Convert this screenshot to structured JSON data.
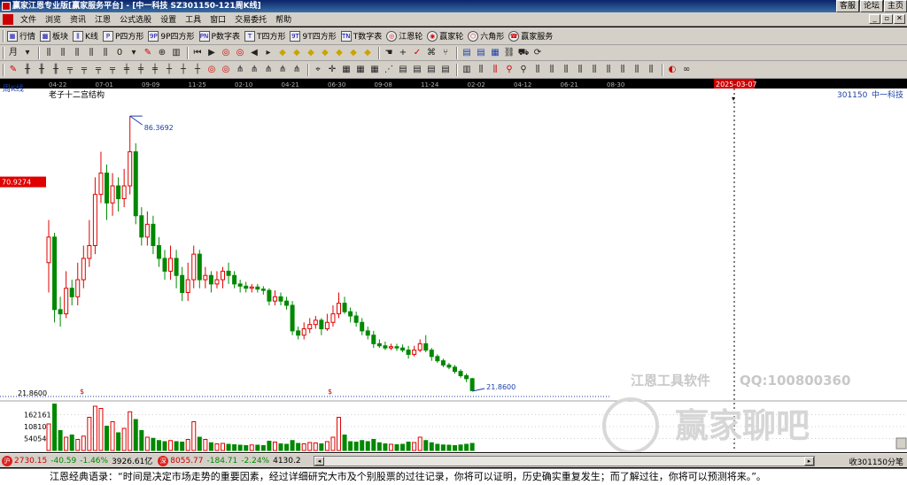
{
  "window": {
    "title": "赢家江恩专业版[赢家服务平台] - [中一科技   SZ301150-121周K线]",
    "links": [
      "客服",
      "论坛",
      "主页"
    ],
    "controls": [
      "_",
      "▫",
      "✕"
    ]
  },
  "menu": [
    "文件",
    "浏览",
    "资讯",
    "江恩",
    "公式选股",
    "设置",
    "工具",
    "窗口",
    "交易委托",
    "帮助"
  ],
  "toolbar1": [
    {
      "icon": "grid-icon",
      "glyph": "▦",
      "label": "行情"
    },
    {
      "icon": "sector-icon",
      "glyph": "▩",
      "label": "板块"
    },
    {
      "icon": "kline-icon",
      "glyph": "⫼",
      "label": "K线"
    },
    {
      "icon": "p-square-icon",
      "glyph": "P",
      "label": "P四方形"
    },
    {
      "icon": "9p-square-icon",
      "glyph": "9P",
      "label": "9P四方形"
    },
    {
      "icon": "p-number-icon",
      "glyph": "PN",
      "label": "P数字表"
    },
    {
      "icon": "t-square-icon",
      "glyph": "T",
      "label": "T四方形"
    },
    {
      "icon": "9t-square-icon",
      "glyph": "9T",
      "label": "9T四方形"
    },
    {
      "icon": "t-number-icon",
      "glyph": "TN",
      "label": "T数字表"
    },
    {
      "icon": "gann-wheel-icon",
      "glyph": "◎",
      "label": "江恩轮"
    },
    {
      "icon": "winner-wheel-icon",
      "glyph": "◉",
      "label": "赢家轮"
    },
    {
      "icon": "hexagon-icon",
      "glyph": "⬡",
      "label": "六角形"
    },
    {
      "icon": "service-icon",
      "glyph": "☎",
      "label": "赢家服务"
    }
  ],
  "toolbar2": {
    "period_label": "月",
    "counter_label": "0"
  },
  "chart_data": {
    "type": "candlestick",
    "period_label": "周K线",
    "title": "老子十二宫结构",
    "stock_code": "301150",
    "stock_name": "中一科技",
    "date_axis": [
      "04-22",
      "07-01",
      "09-09",
      "11-25",
      "02-10",
      "04-21",
      "06-30",
      "09-08",
      "11-24",
      "02-02",
      "04-12",
      "06-21",
      "08-30"
    ],
    "cursor_date": "2025-03-07",
    "high_label": "86.3692",
    "low_label": "21.8600",
    "price_marker": "70.9274",
    "price_axis_label": "21.8600",
    "volume_labels": [
      "162161",
      "108107",
      "54054"
    ],
    "candles": [
      {
        "o": 52,
        "c": 58,
        "h": 62,
        "l": 45
      },
      {
        "o": 58,
        "c": 41,
        "h": 59,
        "l": 38
      },
      {
        "o": 41,
        "c": 40,
        "h": 44,
        "l": 37
      },
      {
        "o": 40,
        "c": 46,
        "h": 50,
        "l": 39
      },
      {
        "o": 46,
        "c": 44,
        "h": 48,
        "l": 42
      },
      {
        "o": 44,
        "c": 48,
        "h": 52,
        "l": 42
      },
      {
        "o": 48,
        "c": 53,
        "h": 56,
        "l": 46
      },
      {
        "o": 53,
        "c": 56,
        "h": 62,
        "l": 51
      },
      {
        "o": 56,
        "c": 68,
        "h": 72,
        "l": 54
      },
      {
        "o": 68,
        "c": 73,
        "h": 78,
        "l": 66
      },
      {
        "o": 73,
        "c": 66,
        "h": 75,
        "l": 62
      },
      {
        "o": 66,
        "c": 70,
        "h": 73,
        "l": 63
      },
      {
        "o": 70,
        "c": 67,
        "h": 72,
        "l": 64
      },
      {
        "o": 67,
        "c": 70,
        "h": 74,
        "l": 65
      },
      {
        "o": 70,
        "c": 78,
        "h": 86.37,
        "l": 68
      },
      {
        "o": 78,
        "c": 63,
        "h": 80,
        "l": 61
      },
      {
        "o": 63,
        "c": 58,
        "h": 65,
        "l": 56
      },
      {
        "o": 58,
        "c": 61,
        "h": 64,
        "l": 56
      },
      {
        "o": 61,
        "c": 56,
        "h": 63,
        "l": 54
      },
      {
        "o": 56,
        "c": 53,
        "h": 58,
        "l": 51
      },
      {
        "o": 53,
        "c": 50,
        "h": 55,
        "l": 48
      },
      {
        "o": 50,
        "c": 53,
        "h": 56,
        "l": 48
      },
      {
        "o": 53,
        "c": 49,
        "h": 55,
        "l": 46
      },
      {
        "o": 49,
        "c": 45,
        "h": 51,
        "l": 43
      },
      {
        "o": 45,
        "c": 48,
        "h": 52,
        "l": 43
      },
      {
        "o": 48,
        "c": 54,
        "h": 56,
        "l": 46
      },
      {
        "o": 54,
        "c": 48,
        "h": 55,
        "l": 46
      },
      {
        "o": 48,
        "c": 49,
        "h": 51,
        "l": 46
      },
      {
        "o": 49,
        "c": 47,
        "h": 50,
        "l": 45
      },
      {
        "o": 47,
        "c": 48,
        "h": 50,
        "l": 46
      },
      {
        "o": 48,
        "c": 50,
        "h": 51,
        "l": 46
      },
      {
        "o": 50,
        "c": 49,
        "h": 52,
        "l": 47
      },
      {
        "o": 49,
        "c": 47,
        "h": 50,
        "l": 46
      },
      {
        "o": 47,
        "c": 46.5,
        "h": 48,
        "l": 45
      },
      {
        "o": 46.5,
        "c": 46,
        "h": 47.5,
        "l": 45
      },
      {
        "o": 46,
        "c": 46.3,
        "h": 47,
        "l": 45
      },
      {
        "o": 46.3,
        "c": 45.8,
        "h": 47,
        "l": 45
      },
      {
        "o": 45.8,
        "c": 45.5,
        "h": 46.5,
        "l": 44.5
      },
      {
        "o": 45.5,
        "c": 43,
        "h": 46,
        "l": 42
      },
      {
        "o": 43,
        "c": 44,
        "h": 45.5,
        "l": 42
      },
      {
        "o": 44,
        "c": 43,
        "h": 45,
        "l": 42
      },
      {
        "o": 43,
        "c": 42,
        "h": 44,
        "l": 41
      },
      {
        "o": 42,
        "c": 36,
        "h": 43,
        "l": 35
      },
      {
        "o": 36,
        "c": 35,
        "h": 37,
        "l": 34
      },
      {
        "o": 35,
        "c": 36.5,
        "h": 38,
        "l": 34
      },
      {
        "o": 36.5,
        "c": 37.5,
        "h": 39,
        "l": 35.5
      },
      {
        "o": 37.5,
        "c": 38.5,
        "h": 39.5,
        "l": 36.5
      },
      {
        "o": 38.5,
        "c": 36.5,
        "h": 39,
        "l": 35
      },
      {
        "o": 36.5,
        "c": 38,
        "h": 40,
        "l": 36
      },
      {
        "o": 38,
        "c": 40,
        "h": 42,
        "l": 37
      },
      {
        "o": 40,
        "c": 42.5,
        "h": 45,
        "l": 39
      },
      {
        "o": 42.5,
        "c": 40.5,
        "h": 44,
        "l": 40
      },
      {
        "o": 40.5,
        "c": 39.5,
        "h": 41.5,
        "l": 38
      },
      {
        "o": 39.5,
        "c": 38,
        "h": 40.5,
        "l": 37
      },
      {
        "o": 38,
        "c": 36,
        "h": 39,
        "l": 35
      },
      {
        "o": 36,
        "c": 35,
        "h": 37,
        "l": 34
      },
      {
        "o": 35,
        "c": 33,
        "h": 36,
        "l": 32
      },
      {
        "o": 33,
        "c": 32.5,
        "h": 34,
        "l": 32
      },
      {
        "o": 32.5,
        "c": 32,
        "h": 33.5,
        "l": 31.5
      },
      {
        "o": 32,
        "c": 32.3,
        "h": 33,
        "l": 31.5
      },
      {
        "o": 32.3,
        "c": 32,
        "h": 33,
        "l": 31.3
      },
      {
        "o": 32,
        "c": 31.5,
        "h": 32.8,
        "l": 31
      },
      {
        "o": 31.5,
        "c": 30.5,
        "h": 32.5,
        "l": 29.5
      },
      {
        "o": 30.5,
        "c": 31.5,
        "h": 32.5,
        "l": 30
      },
      {
        "o": 31.5,
        "c": 33,
        "h": 34,
        "l": 31
      },
      {
        "o": 33,
        "c": 31.5,
        "h": 35,
        "l": 31
      },
      {
        "o": 31.5,
        "c": 30,
        "h": 32,
        "l": 29
      },
      {
        "o": 30,
        "c": 29,
        "h": 30.5,
        "l": 28.5
      },
      {
        "o": 29,
        "c": 28,
        "h": 29.5,
        "l": 27.5
      },
      {
        "o": 28,
        "c": 27.5,
        "h": 28.5,
        "l": 27
      },
      {
        "o": 27.5,
        "c": 26.5,
        "h": 28,
        "l": 26
      },
      {
        "o": 26.5,
        "c": 25.5,
        "h": 27,
        "l": 25
      },
      {
        "o": 25.5,
        "c": 24.8,
        "h": 26,
        "l": 24
      },
      {
        "o": 24.8,
        "c": 22,
        "h": 25,
        "l": 21.86
      }
    ],
    "volumes": [
      120000,
      210000,
      90000,
      60000,
      70000,
      50000,
      65000,
      150000,
      200000,
      190000,
      110000,
      130000,
      80000,
      100000,
      175000,
      140000,
      90000,
      60000,
      55000,
      45000,
      40000,
      45000,
      40000,
      38000,
      50000,
      130000,
      60000,
      50000,
      35000,
      30000,
      32000,
      28000,
      26000,
      24000,
      22000,
      25000,
      24000,
      22000,
      42000,
      38000,
      30000,
      28000,
      45000,
      32000,
      30000,
      36000,
      34000,
      30000,
      40000,
      60000,
      150000,
      70000,
      40000,
      38000,
      45000,
      40000,
      50000,
      35000,
      30000,
      28000,
      26000,
      28000,
      38000,
      36000,
      60000,
      45000,
      35000,
      28000,
      25000,
      24000,
      22000,
      25000,
      28000,
      32000
    ],
    "volume_max": 216000,
    "price_range": [
      20,
      92
    ]
  },
  "colors": {
    "up": "#e00000",
    "down": "#008800",
    "background": "#ffffff",
    "label_blue": "#1a3fa8"
  },
  "watermark": {
    "company": "江恩工具软件",
    "qq": "QQ:100800360",
    "brand": "赢家聊吧"
  },
  "status": {
    "index1": {
      "icon_label": "沪",
      "value": "2730.15",
      "change": "-40.59",
      "pct": "-1.46%",
      "amount": "3926.61亿"
    },
    "index2": {
      "icon_label": "深",
      "value": "8055.77",
      "change": "-184.71",
      "pct": "-2.24%",
      "amount": "4130.2"
    },
    "right": "收301150分笔"
  },
  "quote": "江恩经典语录：“时间是决定市场走势的重要因素，经过详细研究大市及个别股票的过往记录，你将可以证明，历史确实重复发生；而了解过往，你将可以预测将来。”。"
}
